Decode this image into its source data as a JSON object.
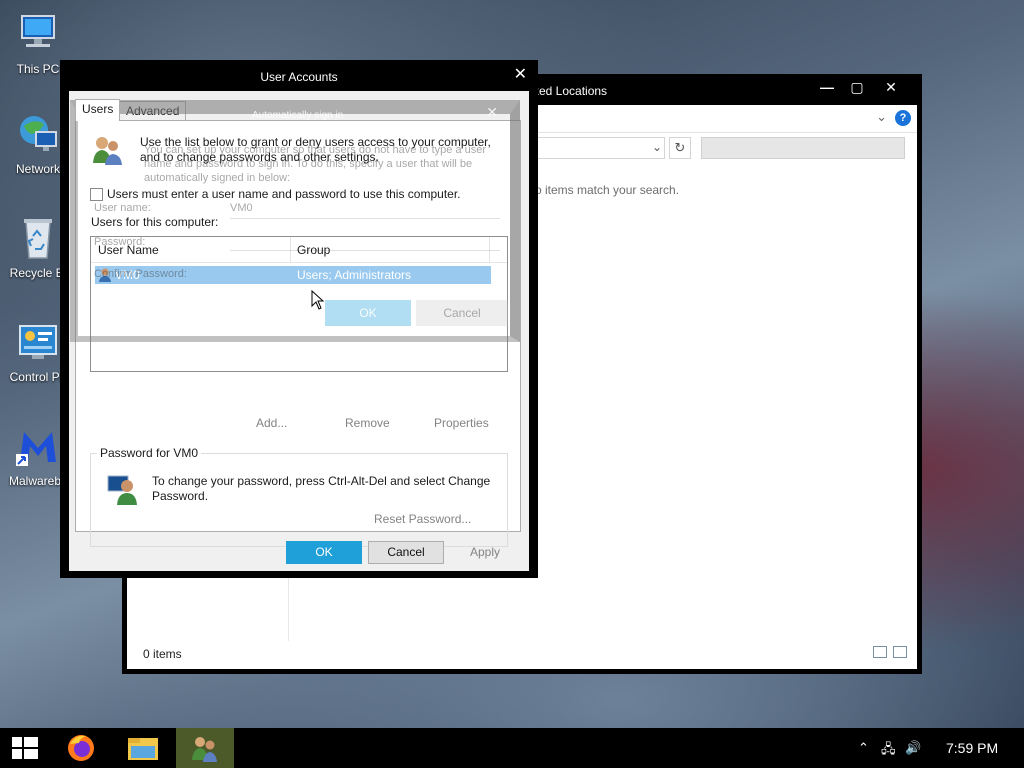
{
  "desktop": {
    "icons": [
      {
        "label": "This PC",
        "icon": "this-pc-icon"
      },
      {
        "label": "Network",
        "icon": "network-icon"
      },
      {
        "label": "Recycle Bi",
        "icon": "recycle-bin-icon"
      },
      {
        "label": "Control Pa",
        "icon": "control-panel-icon"
      },
      {
        "label": "Malwareby",
        "icon": "malwarebytes-icon"
      }
    ]
  },
  "explorer": {
    "title": "xed Locations",
    "minimize": "—",
    "maximize": "▢",
    "close": "✕",
    "help": "?",
    "ribbon_expand": "⌄",
    "address_dropdown": "⌄",
    "refresh": "↻",
    "empty_message": "o items match your search.",
    "status": "0 items"
  },
  "user_accounts": {
    "title": "User Accounts",
    "close": "✕",
    "tabs": [
      "Users",
      "Advanced"
    ],
    "intro": "Use the list below to grant or deny users access to your computer, and to change passwords and other settings.",
    "must_enter_checkbox": "Users must enter a user name and password to use this computer.",
    "must_enter_checked": false,
    "users_label": "Users for this computer:",
    "columns": [
      "User Name",
      "Group"
    ],
    "rows": [
      {
        "user_name": "VM0",
        "group": "Users; Administrators",
        "selected": true
      }
    ],
    "add_button": "Add...",
    "remove_button": "Remove",
    "properties_button": "Properties",
    "password_group_title": "Password for VM0",
    "password_text": "To change your password, press Ctrl-Alt-Del and select Change Password.",
    "reset_password_button": "Reset Password...",
    "ok_button": "OK",
    "cancel_button": "Cancel",
    "apply_button": "Apply"
  },
  "ghost_dialog": {
    "title": "Automatically sign in",
    "close": "✕",
    "line1": "You can set up your computer so that users do not have to type a user",
    "line2": "name and password to sign in. To do this, specify a user that will be",
    "line3": "automatically signed in below:",
    "user_name_label": "User name:",
    "user_name_value": "VM0",
    "password_label": "Password:",
    "confirm_label": "Confirm Password:",
    "ok": "OK",
    "cancel": "Cancel"
  },
  "taskbar": {
    "time": "7:59 PM",
    "apps": [
      "start-icon",
      "firefox-icon",
      "file-explorer-icon",
      "user-accounts-icon"
    ]
  },
  "colors": {
    "accent": "#1fa0d9",
    "selection": "#99c9ef",
    "taskbar": "#000000"
  }
}
